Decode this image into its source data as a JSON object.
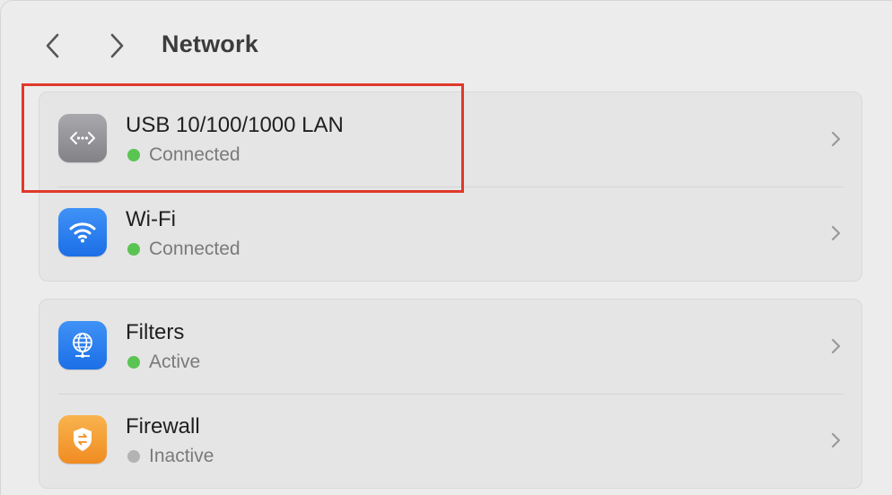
{
  "window": {
    "title": "Network"
  },
  "toolbar": {
    "back_icon": "chevron-left-icon",
    "forward_icon": "chevron-right-icon"
  },
  "groups": [
    {
      "items": [
        {
          "title": "USB 10/100/1000 LAN",
          "status": "Connected",
          "status_color": "#5ac453",
          "icon": "ethernet-icon",
          "icon_color": "#97979b"
        },
        {
          "title": "Wi-Fi",
          "status": "Connected",
          "status_color": "#5ac453",
          "icon": "wifi-icon",
          "icon_color": "#2d80f0"
        }
      ]
    },
    {
      "items": [
        {
          "title": "Filters",
          "status": "Active",
          "status_color": "#5ac453",
          "icon": "globe-filter-icon",
          "icon_color": "#2d80f0"
        },
        {
          "title": "Firewall",
          "status": "Inactive",
          "status_color": "#b3b3b3",
          "icon": "shield-icon",
          "icon_color": "#f4a03a"
        }
      ]
    }
  ],
  "highlight": {
    "color": "#e0392b"
  }
}
